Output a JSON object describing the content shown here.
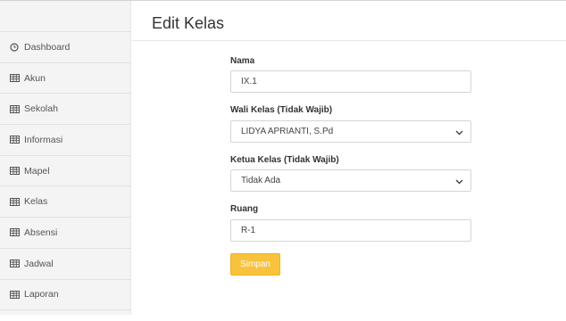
{
  "sidebar": {
    "items": [
      {
        "label": "Dashboard",
        "icon": "clock-icon"
      },
      {
        "label": "Akun",
        "icon": "table-icon"
      },
      {
        "label": "Sekolah",
        "icon": "table-icon"
      },
      {
        "label": "Informasi",
        "icon": "table-icon"
      },
      {
        "label": "Mapel",
        "icon": "table-icon"
      },
      {
        "label": "Kelas",
        "icon": "table-icon"
      },
      {
        "label": "Absensi",
        "icon": "table-icon"
      },
      {
        "label": "Jadwal",
        "icon": "table-icon"
      },
      {
        "label": "Laporan",
        "icon": "table-icon"
      }
    ]
  },
  "page": {
    "title": "Edit Kelas"
  },
  "form": {
    "nama": {
      "label": "Nama",
      "value": "IX.1"
    },
    "wali": {
      "label": "Wali Kelas (Tidak Wajib)",
      "value": "LIDYA APRIANTI, S.Pd"
    },
    "ketua": {
      "label": "Ketua Kelas (Tidak Wajib)",
      "value": "Tidak Ada"
    },
    "ruang": {
      "label": "Ruang",
      "value": "R-1"
    },
    "save_label": "Simpan"
  },
  "colors": {
    "accent": "#f9c23c",
    "sidebar_bg": "#f4f4f4"
  }
}
